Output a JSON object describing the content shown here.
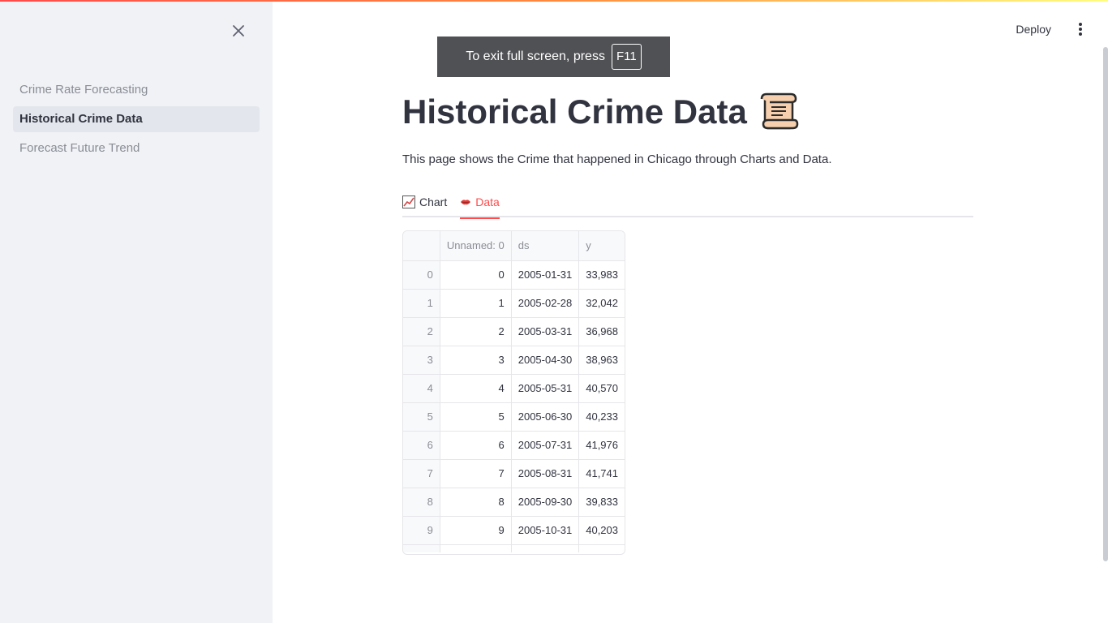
{
  "sidebar": {
    "items": [
      {
        "label": "Crime Rate Forecasting"
      },
      {
        "label": "Historical Crime Data"
      },
      {
        "label": "Forecast Future Trend"
      }
    ],
    "active_index": 1,
    "close_icon": "close-icon"
  },
  "header": {
    "deploy_label": "Deploy",
    "menu_icon": "kebab-menu-icon"
  },
  "toast": {
    "text": "To exit full screen, press",
    "key": "F11"
  },
  "main": {
    "title": "Historical Crime Data",
    "title_icon": "scroll-icon",
    "description": "This page shows the Crime that happened in Chicago through Charts and Data.",
    "tabs": [
      {
        "label": "Chart",
        "icon": "chart-icon"
      },
      {
        "label": "Data",
        "icon": "lips-icon"
      }
    ],
    "active_tab": 1
  },
  "table": {
    "columns": [
      "",
      "Unnamed: 0",
      "ds",
      "y"
    ],
    "rows": [
      [
        "0",
        "0",
        "2005-01-31",
        "33,983"
      ],
      [
        "1",
        "1",
        "2005-02-28",
        "32,042"
      ],
      [
        "2",
        "2",
        "2005-03-31",
        "36,968"
      ],
      [
        "3",
        "3",
        "2005-04-30",
        "38,963"
      ],
      [
        "4",
        "4",
        "2005-05-31",
        "40,570"
      ],
      [
        "5",
        "5",
        "2005-06-30",
        "40,233"
      ],
      [
        "6",
        "6",
        "2005-07-31",
        "41,976"
      ],
      [
        "7",
        "7",
        "2005-08-31",
        "41,741"
      ],
      [
        "8",
        "8",
        "2005-09-30",
        "39,833"
      ],
      [
        "9",
        "9",
        "2005-10-31",
        "40,203"
      ]
    ]
  },
  "colors": {
    "accent": "#ff4b4b",
    "sidebar_bg": "#f0f2f6",
    "text": "#31333f"
  }
}
